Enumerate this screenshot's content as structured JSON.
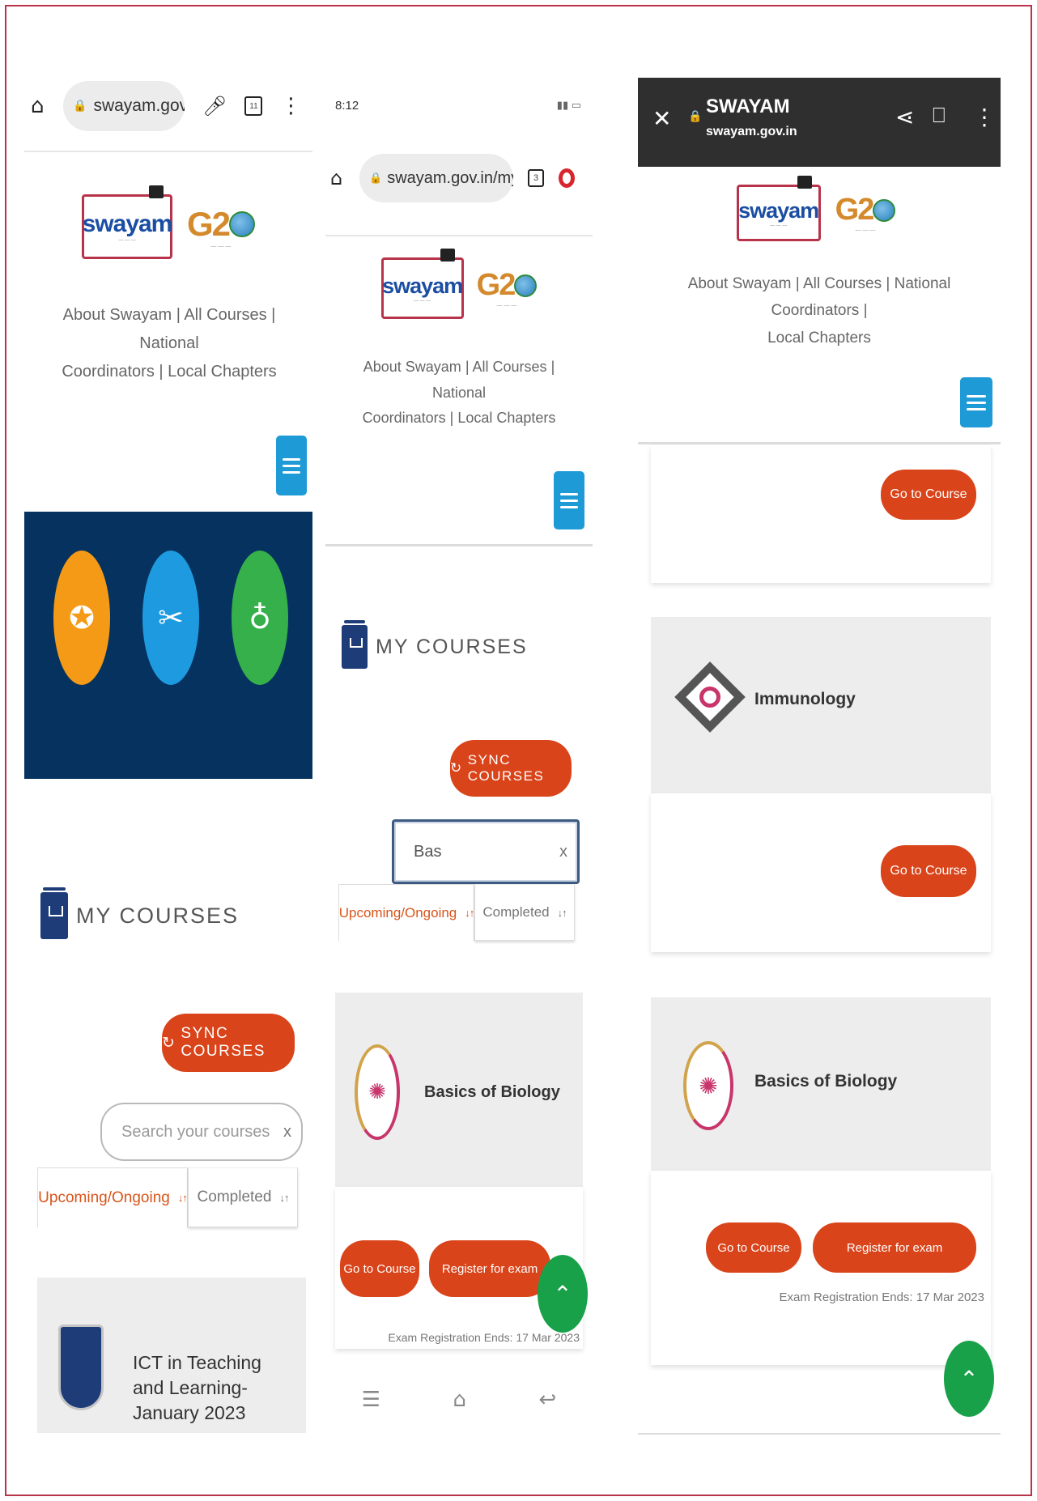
{
  "brand": {
    "logo_word": "swayam",
    "g20_text": "G2"
  },
  "nav_links": {
    "about": "About Swayam",
    "courses": "All Courses",
    "national": "National",
    "coordinators": "Coordinators",
    "national_coordinators": "National Coordinators",
    "local_chapters": "Local Chapters",
    "sep": "|"
  },
  "panel1": {
    "url": "swayam.gov.in/n",
    "tab_count": "11",
    "my_courses": "MY COURSES",
    "sync_button": "SYNC COURSES",
    "search_placeholder": "Search your courses",
    "clear": "x",
    "tab_upcoming": "Upcoming/Ongoing",
    "tab_completed": "Completed",
    "course_title": "ICT in Teaching and Learning- January 2023",
    "hero_icons": [
      "award-icon",
      "tools-icon",
      "medal-icon"
    ]
  },
  "panel2": {
    "status_time": "8:12",
    "url": "swayam.gov.in/mycours",
    "tab_count": "3",
    "my_courses": "MY COURSES",
    "sync_button": "SYNC COURSES",
    "search_value": "Bas",
    "clear": "x",
    "tab_upcoming": "Upcoming/Ongoing",
    "tab_completed": "Completed",
    "course_title": "Basics of Biology",
    "go_to_course": "Go to Course",
    "register_exam": "Register for exam",
    "exam_end": "Exam Registration Ends: 17 Mar 2023"
  },
  "panel3": {
    "site_title": "SWAYAM",
    "site_url": "swayam.gov.in",
    "go_to_course": "Go to Course",
    "course1_title": "Immunology",
    "course2_title": "Basics of Biology",
    "register_exam": "Register for exam",
    "exam_end": "Exam Registration Ends: 17 Mar 2023"
  },
  "sort_glyph": "↓↑",
  "colors": {
    "accent": "#d9441a",
    "brand_blue": "#1b4ea2",
    "hamburger": "#1e9ad6",
    "hero_bg": "#05325e",
    "fab": "#19a14a"
  }
}
